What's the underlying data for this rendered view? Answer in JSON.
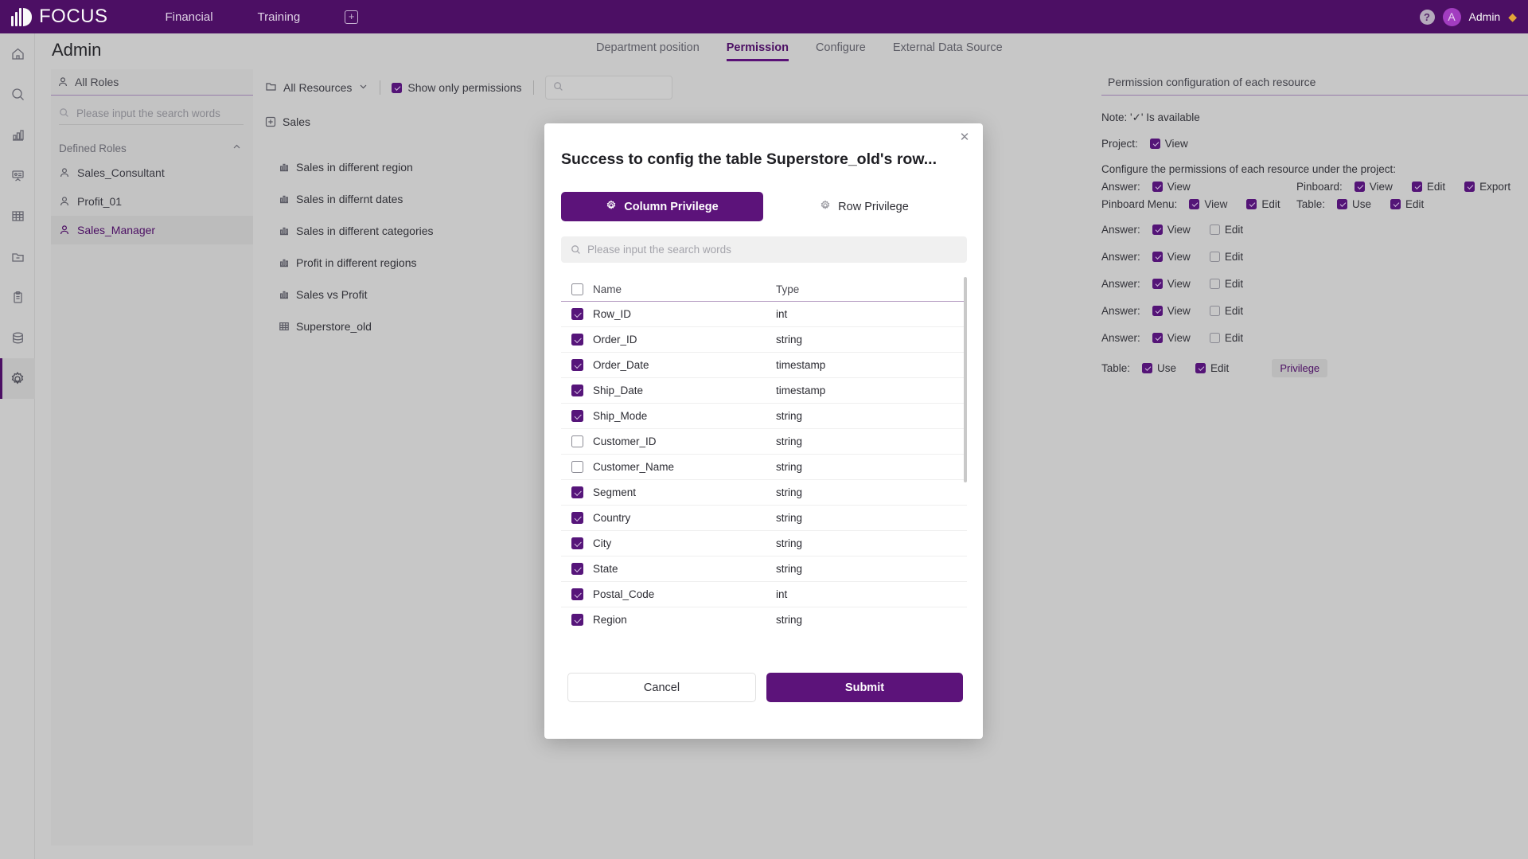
{
  "topbar": {
    "logo_text": "FOCUS",
    "nav": [
      {
        "label": "Financial"
      },
      {
        "label": "Training"
      }
    ],
    "add_label": "+",
    "help_label": "?",
    "avatar_letter": "A",
    "user_name": "Admin"
  },
  "page": {
    "title": "Admin",
    "subtabs": [
      {
        "label": "Department position",
        "active": false
      },
      {
        "label": "Permission",
        "active": true
      },
      {
        "label": "Configure",
        "active": false
      },
      {
        "label": "External Data Source",
        "active": false
      }
    ]
  },
  "roles_panel": {
    "header": "All Roles",
    "search_placeholder": "Please input the search words",
    "group_label": "Defined Roles",
    "items": [
      {
        "label": "Sales_Consultant",
        "selected": false
      },
      {
        "label": "Profit_01",
        "selected": false
      },
      {
        "label": "Sales_Manager",
        "selected": true
      }
    ]
  },
  "resources_panel": {
    "dropdown_label": "All Resources",
    "show_only_permissions_label": "Show only permissions",
    "show_only_permissions_checked": true,
    "search_placeholder": "",
    "items": [
      {
        "label": "Sales",
        "icon": "plus-box-icon",
        "indent": false
      },
      {
        "label": "Sales in different region",
        "icon": "chart-icon",
        "indent": true
      },
      {
        "label": "Sales in differnt dates",
        "icon": "chart-icon",
        "indent": true
      },
      {
        "label": "Sales in different categories",
        "icon": "chart-icon",
        "indent": true
      },
      {
        "label": "Profit in different regions",
        "icon": "chart-icon",
        "indent": true
      },
      {
        "label": "Sales vs Profit",
        "icon": "chart-icon",
        "indent": true
      },
      {
        "label": "Superstore_old",
        "icon": "table-icon",
        "indent": true
      }
    ]
  },
  "permission_panel": {
    "header": "Permission configuration of each resource",
    "note": "Note: '✓' Is available",
    "project_label": "Project:",
    "project_view_label": "View",
    "project_view_checked": true,
    "configure_text": "Configure the permissions of each resource under the project:",
    "answer_label": "Answer:",
    "answer_view_label": "View",
    "answer_view_checked": true,
    "pinboard_label": "Pinboard:",
    "pinboard_view_label": "View",
    "pinboard_view_checked": true,
    "pinboard_edit_label": "Edit",
    "pinboard_edit_checked": true,
    "pinboard_export_label": "Export",
    "pinboard_export_checked": true,
    "pinboard_menu_label": "Pinboard Menu:",
    "pinboard_menu_view_label": "View",
    "pinboard_menu_view_checked": true,
    "pinboard_menu_edit_label": "Edit",
    "pinboard_menu_edit_checked": true,
    "table_label": "Table:",
    "table_use_label": "Use",
    "table_use_checked": true,
    "table_edit_label": "Edit",
    "table_edit_checked": true,
    "answer_rows": [
      {
        "label": "Answer:",
        "view_label": "View",
        "view_checked": true,
        "edit_label": "Edit",
        "edit_checked": false
      },
      {
        "label": "Answer:",
        "view_label": "View",
        "view_checked": true,
        "edit_label": "Edit",
        "edit_checked": false
      },
      {
        "label": "Answer:",
        "view_label": "View",
        "view_checked": true,
        "edit_label": "Edit",
        "edit_checked": false
      },
      {
        "label": "Answer:",
        "view_label": "View",
        "view_checked": true,
        "edit_label": "Edit",
        "edit_checked": false
      },
      {
        "label": "Answer:",
        "view_label": "View",
        "view_checked": true,
        "edit_label": "Edit",
        "edit_checked": false
      }
    ],
    "table_row": {
      "label": "Table:",
      "use_label": "Use",
      "use_checked": true,
      "edit_label": "Edit",
      "edit_checked": true,
      "privilege_label": "Privilege"
    }
  },
  "modal": {
    "title": "Success to config the table Superstore_old's row...",
    "close_label": "✕",
    "tabs": [
      {
        "label": "Column Privilege",
        "active": true
      },
      {
        "label": "Row Privilege",
        "active": false
      }
    ],
    "search_placeholder": "Please input the search words",
    "columns": [
      {
        "label": "Name"
      },
      {
        "label": "Type"
      }
    ],
    "select_all_checked": false,
    "rows": [
      {
        "name": "Row_ID",
        "type": "int",
        "checked": true
      },
      {
        "name": "Order_ID",
        "type": "string",
        "checked": true
      },
      {
        "name": "Order_Date",
        "type": "timestamp",
        "checked": true
      },
      {
        "name": "Ship_Date",
        "type": "timestamp",
        "checked": true
      },
      {
        "name": "Ship_Mode",
        "type": "string",
        "checked": true
      },
      {
        "name": "Customer_ID",
        "type": "string",
        "checked": false
      },
      {
        "name": "Customer_Name",
        "type": "string",
        "checked": false
      },
      {
        "name": "Segment",
        "type": "string",
        "checked": true
      },
      {
        "name": "Country",
        "type": "string",
        "checked": true
      },
      {
        "name": "City",
        "type": "string",
        "checked": true
      },
      {
        "name": "State",
        "type": "string",
        "checked": true
      },
      {
        "name": "Postal_Code",
        "type": "int",
        "checked": true
      },
      {
        "name": "Region",
        "type": "string",
        "checked": true
      }
    ],
    "cancel_label": "Cancel",
    "submit_label": "Submit"
  },
  "colors": {
    "brand_purple": "#4e1066",
    "accent_purple": "#5c137a",
    "page_bg": "#cbcbcb"
  }
}
